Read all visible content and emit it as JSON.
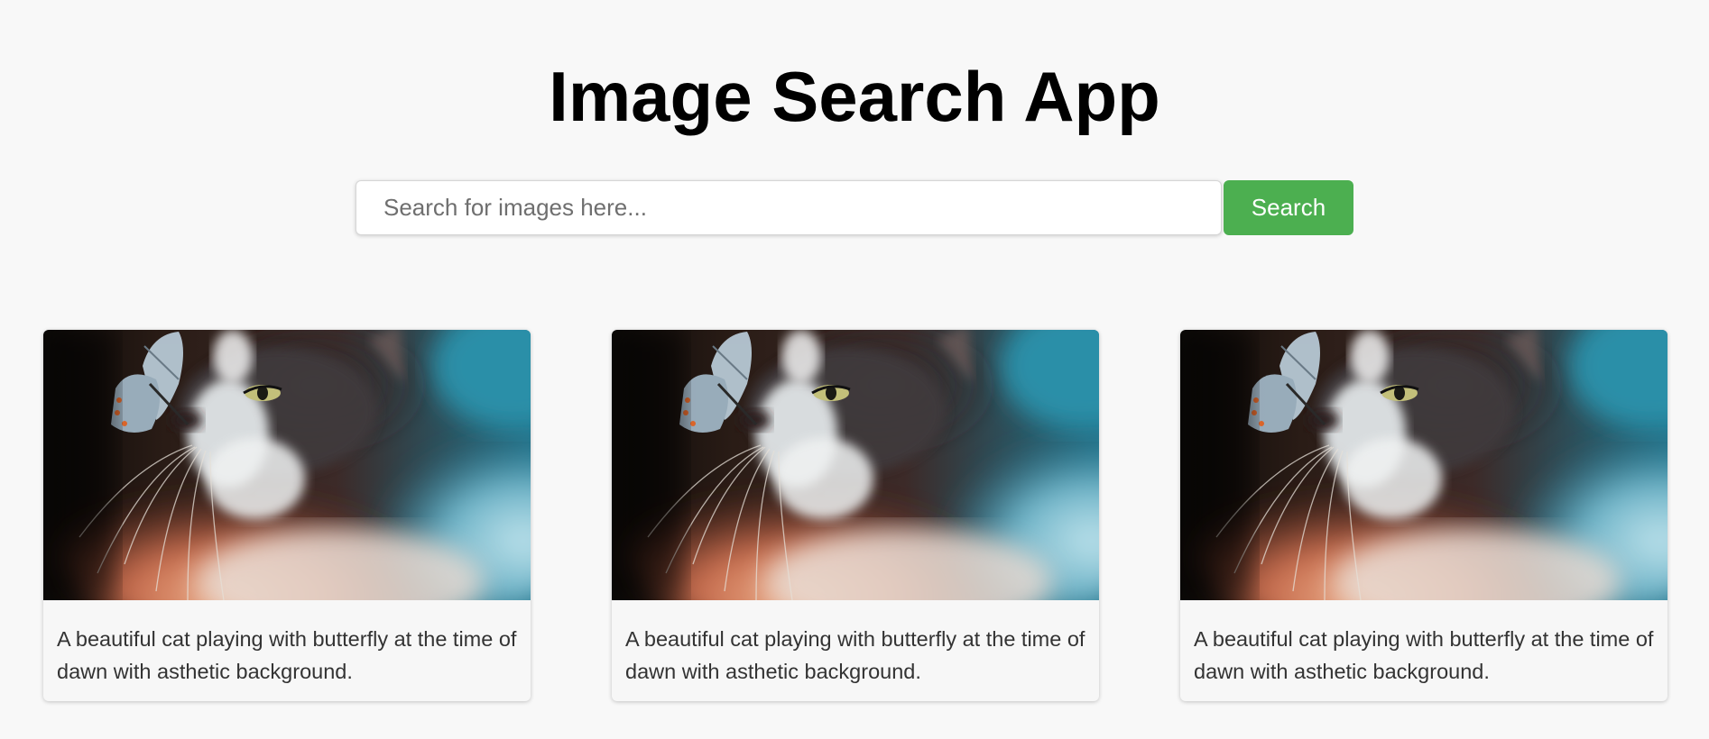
{
  "header": {
    "title": "Image Search App"
  },
  "search": {
    "placeholder": "Search for images here...",
    "value": "",
    "button_label": "Search",
    "button_color": "#4caf50"
  },
  "results": [
    {
      "image_alt": "cat with butterfly",
      "caption": "A beautiful cat playing with butterfly at the time of dawn with asthetic background."
    },
    {
      "image_alt": "cat with butterfly",
      "caption": "A beautiful cat playing with butterfly at the time of dawn with asthetic background."
    },
    {
      "image_alt": "cat with butterfly",
      "caption": "A beautiful cat playing with butterfly at the time of dawn with asthetic background."
    }
  ]
}
